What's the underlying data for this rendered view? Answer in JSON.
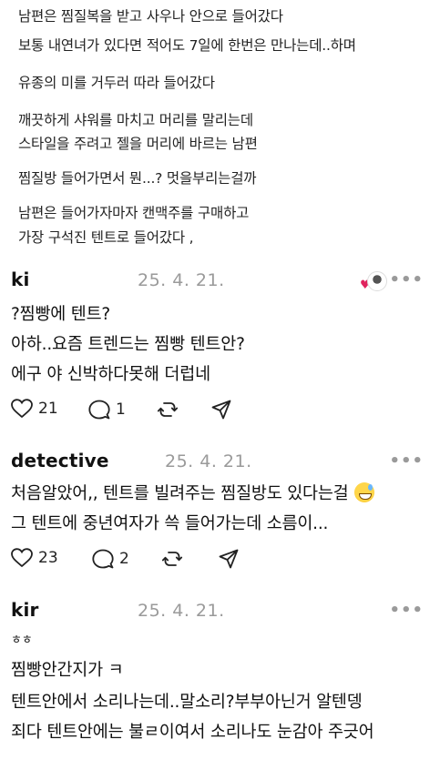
{
  "post": {
    "lines": [
      "남편은 찜질복을 받고 사우나 안으로 들어갔다",
      "보통 내연녀가 있다면 적어도 7일에 한번은 만나는데..하며",
      "유종의 미를 거두러 따라 들어갔다",
      "깨끗하게 샤워를 마치고 머리를 말리는데",
      "스타일을 주려고 젤을 머리에 바르는 남편",
      "찜질방 들어가면서 뭔...? 멋을부리는걸까",
      "남편은 들어가자마자 캔맥주를 구매하고",
      "가장 구석진 텐트로 들어갔다 ,"
    ]
  },
  "comments": [
    {
      "username": "ki",
      "date": "25. 4. 21.",
      "more": "•••",
      "lines": [
        "?찜빵에 텐트?",
        "아하..요즘 트렌드는 찜빵 텐트안?",
        "에구 야 신박하다못해 더럽네"
      ],
      "likes": "21",
      "replies": "1",
      "liked_by_author": true
    },
    {
      "username": "detective",
      "date": "25. 4. 21.",
      "more": "•••",
      "lines": [
        "처음알았어,, 텐트를 빌려주는 찜질방도 있다는걸",
        "그 텐트에 중년여자가 쓱 들어가는데 소름이..."
      ],
      "emoji": "sweat-smile-emoji",
      "likes": "23",
      "replies": "2"
    },
    {
      "username": "kir",
      "date": "25. 4. 21.",
      "more": "•••",
      "lines": [
        "ㅎㅎ",
        "찜빵안간지가 ㅋ",
        "텐트안에서 소리나는데..말소리?부부아닌거 알텐뎅",
        "죄다 텐트안에는 불ㄹ이여서 소리나도 눈감아 주긋어"
      ]
    }
  ],
  "colors": {
    "heart_liked": "#e0245e",
    "meta_gray": "#9a9a9a",
    "text": "#111111"
  },
  "icons": [
    "heart-icon",
    "comment-bubble-icon",
    "repost-icon",
    "share-send-icon",
    "more-options-icon"
  ]
}
